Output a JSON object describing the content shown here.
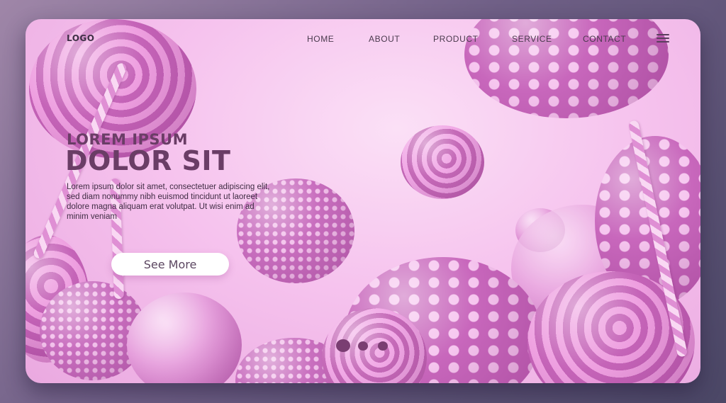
{
  "nav": {
    "logo": "LOGO",
    "links": [
      "HOME",
      "ABOUT",
      "PRODUCT",
      "SERVICE",
      "CONTACT"
    ],
    "menu_icon": "hamburger-menu-icon"
  },
  "hero": {
    "subtitle": "LOREM IPSUM",
    "title": "DOLOR SIT",
    "body": "Lorem ipsum dolor sit amet, consectetuer adipiscing elit, sed diam nonummy nibh euismod tincidunt ut laoreet dolore magna aliquam erat volutpat. Ut wisi enim ad minim veniam",
    "cta_label": "See More"
  },
  "pagination": {
    "total": 3,
    "active_index": 0
  },
  "colors": {
    "page_background": "#6f5f86",
    "card_background": "#f6c3ee",
    "title_color": "#6a3d66",
    "accent_pink": "#c867bc"
  }
}
